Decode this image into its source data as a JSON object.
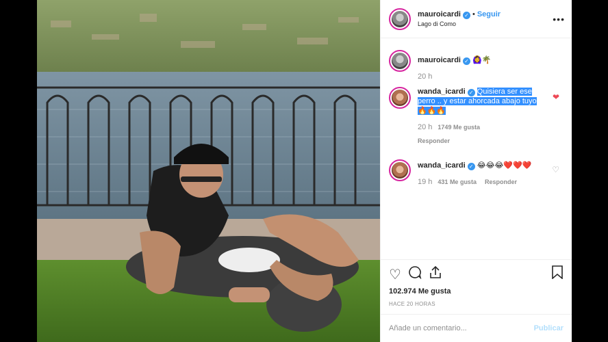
{
  "post": {
    "username": "mauroicardi",
    "follow_label": "Seguir",
    "location": "Lago di Como",
    "more_glyph": "•••"
  },
  "caption": {
    "username": "mauroicardi",
    "text": "🙆‍♀️🌴",
    "time": "20 h"
  },
  "comments": [
    {
      "username": "wanda_icardi",
      "text": "Quisiera ser ese perro .. y estar ahorcada abajo tuyo 🔥🔥🔥",
      "time": "20 h",
      "likes": "1749 Me gusta",
      "reply": "Responder",
      "liked": true
    },
    {
      "username": "wanda_icardi",
      "text": "😂😂😂❤️❤️❤️",
      "time": "19 h",
      "likes": "431 Me gusta",
      "reply": "Responder",
      "liked": false
    }
  ],
  "footer": {
    "likes_total": "102.974 Me gusta",
    "ago": "HACE 20 HORAS",
    "comment_placeholder": "Añade un comentario...",
    "publish_label": "Publicar"
  },
  "icons": [
    "heart-icon",
    "comment-icon",
    "share-icon",
    "bookmark-icon",
    "verified-icon",
    "more-icon"
  ],
  "colors": {
    "link": "#3897f0",
    "heart": "#ed4956",
    "highlight": "#3390ff",
    "publish_disabled": "#b2dffc"
  }
}
